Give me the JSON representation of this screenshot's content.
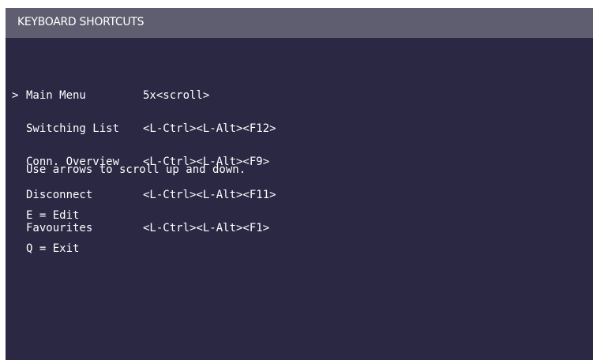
{
  "header": {
    "title": "KEYBOARD SHORTCUTS"
  },
  "menu": {
    "cursor": ">",
    "items": [
      {
        "label": "Main Menu",
        "shortcut": "5x<scroll>"
      },
      {
        "label": "Switching List",
        "shortcut": "<L-Ctrl><L-Alt><F12>"
      },
      {
        "label": "Conn. Overview",
        "shortcut": "<L-Ctrl><L-Alt><F9>"
      },
      {
        "label": "Disconnect",
        "shortcut": "<L-Ctrl><L-Alt><F11>"
      },
      {
        "label": "Favourites",
        "shortcut": "<L-Ctrl><L-Alt><F1>"
      }
    ]
  },
  "help": {
    "hint": "Use arrows to scroll up and down.",
    "keys": [
      "E = Edit",
      "Q = Exit"
    ]
  },
  "colors": {
    "background": "#2a2843",
    "titlebar": "#5f5e70",
    "text": "#ffffff"
  }
}
